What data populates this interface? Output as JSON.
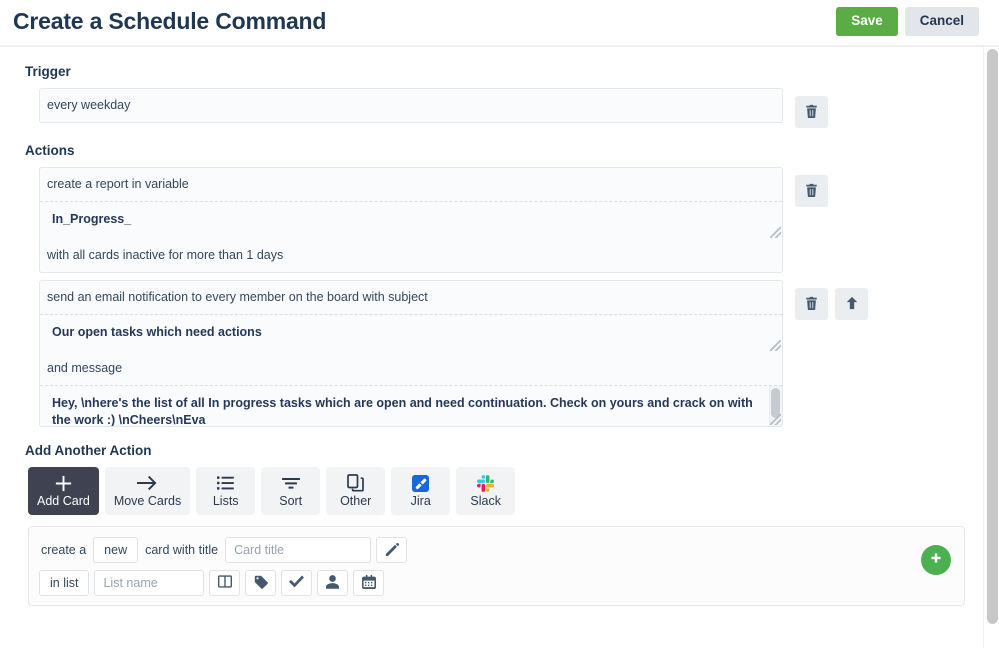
{
  "header": {
    "title": "Create a Schedule Command",
    "save_label": "Save",
    "cancel_label": "Cancel"
  },
  "trigger": {
    "heading": "Trigger",
    "text": "every weekday",
    "delete_icon": "trash-icon"
  },
  "actions": {
    "heading": "Actions",
    "items": [
      {
        "prefix": "create a report in variable",
        "value": "In_Progress_",
        "suffix": "with all cards inactive for more than 1 days",
        "buttons": [
          "trash-icon"
        ]
      },
      {
        "prefix": "send an email notification to every member on the board with subject",
        "value": "Our open tasks which need actions",
        "middle": "and message",
        "message": "Hey, \\nhere's the list of all In progress tasks which are open and need continuation. Check on yours and crack on with the work :) \\nCheers\\nEva",
        "buttons": [
          "trash-icon",
          "arrow-up-icon"
        ]
      }
    ]
  },
  "add_action": {
    "heading": "Add Another Action",
    "tabs": [
      {
        "label": "Add Card",
        "icon": "plus-icon",
        "active": true
      },
      {
        "label": "Move Cards",
        "icon": "arrow-right-icon",
        "active": false
      },
      {
        "label": "Lists",
        "icon": "list-icon",
        "active": false
      },
      {
        "label": "Sort",
        "icon": "sort-icon",
        "active": false
      },
      {
        "label": "Other",
        "icon": "copy-icon",
        "active": false
      },
      {
        "label": "Jira",
        "icon": "jira-icon",
        "active": false
      },
      {
        "label": "Slack",
        "icon": "slack-icon",
        "active": false
      }
    ]
  },
  "builder": {
    "text_create_a": "create a",
    "pill_new": "new",
    "text_card_with_title": "card with title",
    "card_title_placeholder": "Card title",
    "edit_icon": "edit-pencil-icon",
    "pill_in_list": "in list",
    "list_name_placeholder": "List name",
    "icon_buttons": [
      "board-columns-icon",
      "label-tag-icon",
      "checkmark-icon",
      "person-icon",
      "calendar-icon"
    ],
    "add_button_icon": "plus-icon"
  },
  "colors": {
    "save_green": "#5aac44",
    "add_green": "#4caf50",
    "active_tab": "#3f4250",
    "text": "#253858"
  }
}
